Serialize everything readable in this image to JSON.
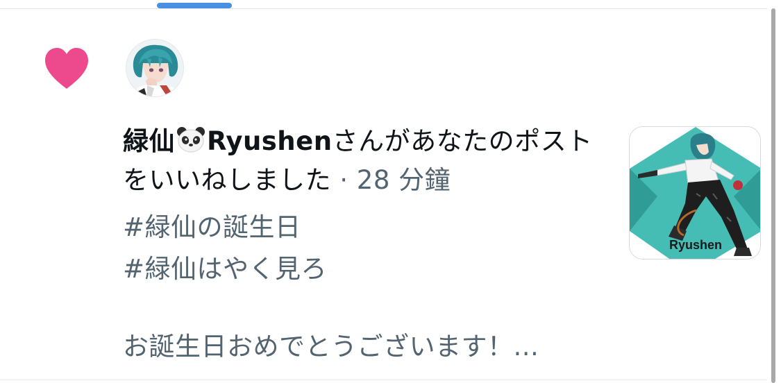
{
  "notification": {
    "type_icon": "heart-icon",
    "user_name": "緑仙",
    "user_emoji": "panda-face-emoji",
    "user_handle_text": "Ryushen",
    "action_text": "さんがあなたのポストをいいねしました",
    "separator": " · ",
    "timestamp": "28 分鐘",
    "hashtags": [
      "#緑仙の誕生日",
      "#緑仙はやく見ろ"
    ],
    "excerpt": "お誕生日おめでとうございます！...",
    "media": {
      "title": "Ryushen"
    }
  },
  "colors": {
    "heart": "#ec4a8c",
    "text_primary": "#0f1419",
    "text_secondary": "#536471",
    "tab_indicator": "#4a90e2",
    "thumb_teal": "#46bdb4"
  }
}
